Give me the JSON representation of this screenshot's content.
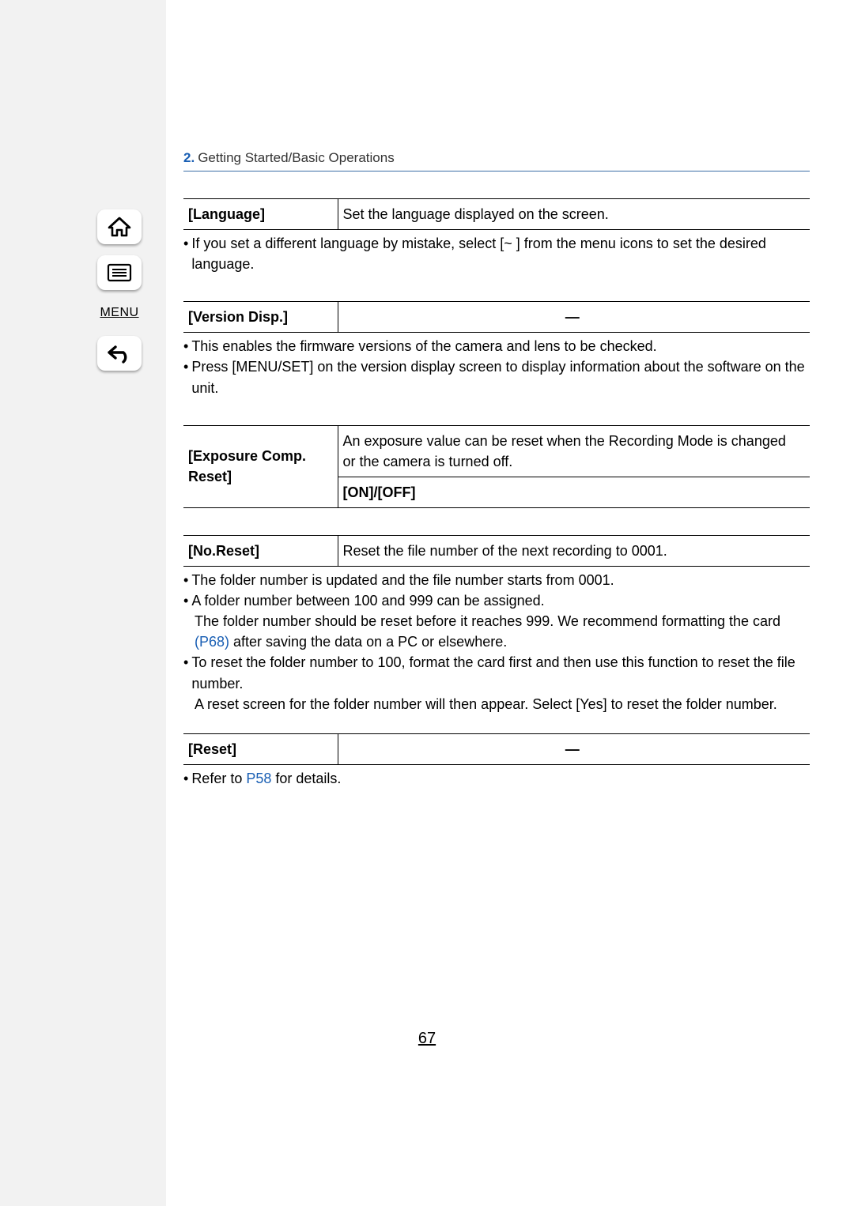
{
  "breadcrumb": {
    "num": "2.",
    "title": "Getting Started/Basic Operations"
  },
  "sidebar": {
    "menu_label": "MENU"
  },
  "language": {
    "name": "[Language]",
    "desc": "Set the language displayed on the screen.",
    "note1_a": "If you set a different language by mistake, select [",
    "note1_b": "~",
    "note1_c": " ] from the menu icons to set the desired language."
  },
  "version": {
    "name": "[Version Disp.]",
    "desc": "—",
    "note1": "This enables the firmware versions of the camera and lens to be checked.",
    "note2": "Press [MENU/SET] on the version display screen to display information about the software on the unit."
  },
  "exposure": {
    "name": "[Exposure Comp. Reset]",
    "desc": "An exposure value can be reset when the Recording Mode is changed or the camera is turned off.",
    "options": "[ON]/[OFF]"
  },
  "noreset": {
    "name": "[No.Reset]",
    "desc": "Reset the file number of the next recording to 0001.",
    "note1": "The folder number is updated and the file number starts from 0001.",
    "note2": "A folder number between 100 and 999 can be assigned.",
    "note2b_pre": "The folder number should be reset before it reaches 999. We recommend formatting the card ",
    "note2b_link": "(P68)",
    "note2b_post": " after saving the data on a PC or elsewhere.",
    "note3": "To reset the folder number to 100, format the card first and then use this function to reset the file number.",
    "note3b": "A reset screen for the folder number will then appear. Select [Yes] to reset the folder number."
  },
  "reset": {
    "name": "[Reset]",
    "desc": "—",
    "note1_pre": "Refer to ",
    "note1_link": "P58",
    "note1_post": " for details."
  },
  "page_number": "67"
}
